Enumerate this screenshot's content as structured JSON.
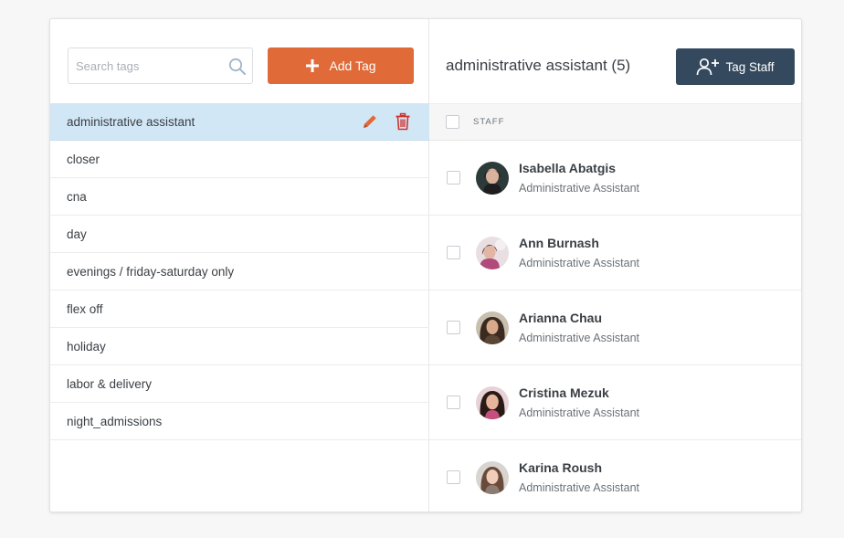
{
  "search": {
    "placeholder": "Search tags",
    "value": ""
  },
  "add_tag_button": {
    "label": "Add Tag"
  },
  "tags": [
    {
      "label": "administrative assistant",
      "active": true
    },
    {
      "label": "closer"
    },
    {
      "label": "cna"
    },
    {
      "label": "day"
    },
    {
      "label": "evenings / friday-saturday only"
    },
    {
      "label": "flex off"
    },
    {
      "label": "holiday"
    },
    {
      "label": "labor & delivery"
    },
    {
      "label": "night_admissions"
    }
  ],
  "detail": {
    "title": "administrative assistant (5)",
    "tag_staff_label": "Tag Staff",
    "header_label": "STAFF"
  },
  "staff": [
    {
      "name": "Isabella Abatgis",
      "role": "Administrative Assistant"
    },
    {
      "name": "Ann Burnash",
      "role": "Administrative Assistant"
    },
    {
      "name": "Arianna Chau",
      "role": "Administrative Assistant"
    },
    {
      "name": "Cristina Mezuk",
      "role": "Administrative Assistant"
    },
    {
      "name": "Karina Roush",
      "role": "Administrative Assistant"
    }
  ],
  "colors": {
    "add_button": "#e06a38",
    "tag_staff_button": "#34495e",
    "active_row": "#d2e7f6",
    "edit_icon": "#e06a38",
    "delete_icon": "#d0312d"
  },
  "icons": {
    "search": "search-icon",
    "add": "plus-icon",
    "edit": "pencil-icon",
    "delete": "trash-icon",
    "tag_staff": "add-user-icon"
  }
}
